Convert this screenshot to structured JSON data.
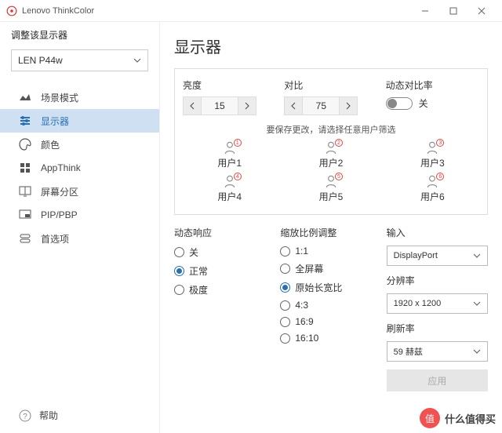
{
  "app": {
    "title": "Lenovo ThinkColor"
  },
  "sidebar": {
    "adjust_label": "调整该显示器",
    "monitor_selected": "LEN P44w",
    "items": [
      {
        "label": "场景模式"
      },
      {
        "label": "显示器"
      },
      {
        "label": "颜色"
      },
      {
        "label": "AppThink"
      },
      {
        "label": "屏幕分区"
      },
      {
        "label": "PIP/PBP"
      },
      {
        "label": "首选项"
      }
    ],
    "help": "帮助"
  },
  "page": {
    "title": "显示器",
    "brightness": {
      "label": "亮度",
      "value": "15"
    },
    "contrast": {
      "label": "对比",
      "value": "75"
    },
    "dcr": {
      "label": "动态对比率",
      "state": "关"
    },
    "save_hint": "要保存更改，请选择任意用户筛选",
    "users": [
      "用户1",
      "用户2",
      "用户3",
      "用户4",
      "用户5",
      "用户6"
    ],
    "dynamic": {
      "label": "动态响应",
      "options": [
        "关",
        "正常",
        "极度"
      ],
      "selected": 1
    },
    "scaling": {
      "label": "缩放比例调整",
      "options": [
        "1:1",
        "全屏幕",
        "原始长宽比",
        "4:3",
        "16:9",
        "16:10"
      ],
      "selected": 2
    },
    "input": {
      "label": "输入",
      "value": "DisplayPort"
    },
    "resolution": {
      "label": "分辨率",
      "value": "1920 x 1200"
    },
    "refresh": {
      "label": "刷新率",
      "value": "59 赫兹"
    },
    "apply": "应用"
  },
  "watermark": {
    "badge": "值",
    "text": "什么值得买"
  }
}
